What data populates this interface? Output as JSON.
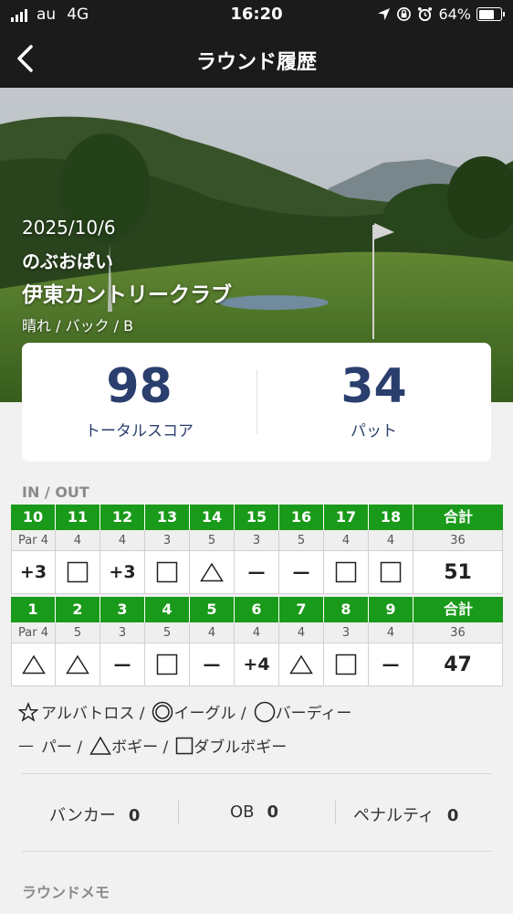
{
  "status_bar": {
    "carrier": "au",
    "network": "4G",
    "time": "16:20",
    "battery": "64%",
    "battery_level": 0.64
  },
  "nav": {
    "title": "ラウンド履歴"
  },
  "round": {
    "date": "2025/10/6",
    "player": "のぶおぱい",
    "course": "伊東カントリークラブ",
    "conditions": "晴れ / バック / B"
  },
  "summary": {
    "total_score": "98",
    "total_label": "トータルスコア",
    "putts": "34",
    "putts_label": "パット"
  },
  "scorecard": {
    "title": "IN / OUT",
    "in": {
      "holes": [
        "10",
        "11",
        "12",
        "13",
        "14",
        "15",
        "16",
        "17",
        "18"
      ],
      "total_label": "合計",
      "pars": [
        "Par 4",
        "4",
        "4",
        "3",
        "5",
        "3",
        "5",
        "4",
        "4"
      ],
      "par_total": "36",
      "results": [
        {
          "type": "text",
          "text": "+3"
        },
        {
          "type": "double-bogey-square"
        },
        {
          "type": "text",
          "text": "+3"
        },
        {
          "type": "double-bogey-square"
        },
        {
          "type": "bogey-triangle"
        },
        {
          "type": "text",
          "text": "—"
        },
        {
          "type": "text",
          "text": "—"
        },
        {
          "type": "double-bogey-square"
        },
        {
          "type": "double-bogey-square"
        }
      ],
      "score_total": "51"
    },
    "out": {
      "holes": [
        "1",
        "2",
        "3",
        "4",
        "5",
        "6",
        "7",
        "8",
        "9"
      ],
      "total_label": "合計",
      "pars": [
        "Par 4",
        "5",
        "3",
        "5",
        "4",
        "4",
        "4",
        "3",
        "4"
      ],
      "par_total": "36",
      "results": [
        {
          "type": "bogey-triangle"
        },
        {
          "type": "bogey-triangle"
        },
        {
          "type": "text",
          "text": "—"
        },
        {
          "type": "double-bogey-square"
        },
        {
          "type": "text",
          "text": "—"
        },
        {
          "type": "text",
          "text": "+4"
        },
        {
          "type": "bogey-triangle"
        },
        {
          "type": "double-bogey-square"
        },
        {
          "type": "text",
          "text": "—"
        }
      ],
      "score_total": "47"
    }
  },
  "legend": {
    "albatross": "アルバトロス /",
    "eagle": "イーグル /",
    "birdie": "バーディー",
    "par_mark": "—",
    "par": "パー /",
    "bogey": "ボギー /",
    "double_bogey": "ダブルボギー"
  },
  "stats": {
    "bunker_label": "バンカー",
    "bunker_value": "0",
    "ob_label": "OB",
    "ob_value": "0",
    "penalty_label": "ペナルティ",
    "penalty_value": "0"
  },
  "memo": {
    "title": "ラウンドメモ"
  },
  "colors": {
    "header_bg": "#1b1b1b",
    "scorecard_green": "#1a9a1a",
    "score_blue": "#2a3f6e"
  }
}
